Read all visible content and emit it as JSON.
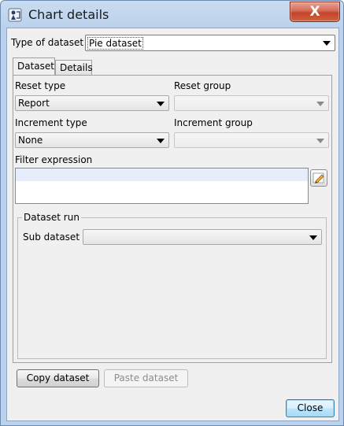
{
  "window": {
    "title": "Chart details",
    "close_glyph": "X"
  },
  "dataset_type": {
    "label": "Type of dataset",
    "value": "Pie dataset"
  },
  "tabs": [
    {
      "label": "Dataset",
      "active": true
    },
    {
      "label": "Details",
      "active": false
    }
  ],
  "reset_type": {
    "label": "Reset type",
    "value": "Report"
  },
  "reset_group": {
    "label": "Reset group",
    "value": ""
  },
  "increment_type": {
    "label": "Increment type",
    "value": "None"
  },
  "increment_group": {
    "label": "Increment group",
    "value": ""
  },
  "filter_expression": {
    "label": "Filter expression",
    "value": ""
  },
  "dataset_run": {
    "legend": "Dataset run",
    "sub_dataset_label": "Sub dataset",
    "sub_dataset_value": ""
  },
  "buttons": {
    "copy": "Copy dataset",
    "paste": "Paste dataset",
    "close": "Close"
  },
  "icons": {
    "app": "jasper-app-icon",
    "edit_expression": "pencil-edit-icon"
  }
}
